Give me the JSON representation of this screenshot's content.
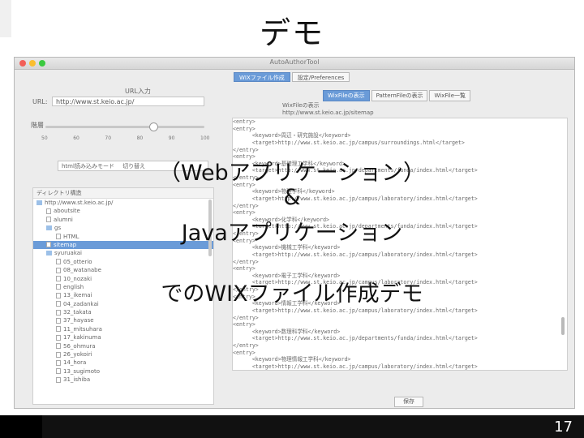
{
  "slide": {
    "title": "デモ",
    "page_number": "17",
    "caption": {
      "line1": "（Webアプリケーション）",
      "line2": "&",
      "line3": "Javaアプリケーション",
      "line4": "でのWIXファイル作成デモ"
    }
  },
  "window": {
    "title": "AutoAuthorTool",
    "tabs": [
      "WIXファイル作成",
      "設定/Preferences"
    ],
    "active_tab": 0
  },
  "left_panel": {
    "url_section_label": "URL入力",
    "url_label": "URL:",
    "url_value": "http://www.st.keio.ac.jp/",
    "depth_label": "階層",
    "slider_ticks": [
      "50",
      "60",
      "70",
      "80",
      "90",
      "100"
    ],
    "slider_value_percent": 68,
    "mode_label": "html読み込みモード",
    "mode_value": "切り替え",
    "tree_header": "ディレクトリ構造",
    "tree": [
      {
        "label": "http://www.st.keio.ac.jp/",
        "type": "folder",
        "level": 0
      },
      {
        "label": "aboutsite",
        "type": "file",
        "level": 1
      },
      {
        "label": "alumni",
        "type": "file",
        "level": 1
      },
      {
        "label": "gs",
        "type": "folder",
        "level": 1
      },
      {
        "label": "HTML",
        "type": "file",
        "level": 2
      },
      {
        "label": "sitemap",
        "type": "file",
        "level": 1,
        "selected": true
      },
      {
        "label": "syuruakai",
        "type": "folder",
        "level": 1
      },
      {
        "label": "05_otterio",
        "type": "file",
        "level": 2
      },
      {
        "label": "08_watanabe",
        "type": "file",
        "level": 2
      },
      {
        "label": "10_nozaki",
        "type": "file",
        "level": 2
      },
      {
        "label": "english",
        "type": "file",
        "level": 2
      },
      {
        "label": "13_ikemai",
        "type": "file",
        "level": 2
      },
      {
        "label": "04_zadankai",
        "type": "file",
        "level": 2
      },
      {
        "label": "32_takata",
        "type": "file",
        "level": 2
      },
      {
        "label": "37_hayase",
        "type": "file",
        "level": 2
      },
      {
        "label": "11_mitsuhara",
        "type": "file",
        "level": 2
      },
      {
        "label": "17_kakinuma",
        "type": "file",
        "level": 2
      },
      {
        "label": "56_ohmura",
        "type": "file",
        "level": 2
      },
      {
        "label": "26_yokoiri",
        "type": "file",
        "level": 2
      },
      {
        "label": "14_hora",
        "type": "file",
        "level": 2
      },
      {
        "label": "13_sugimoto",
        "type": "file",
        "level": 2
      },
      {
        "label": "31_ishiba",
        "type": "file",
        "level": 2
      }
    ]
  },
  "right_panel": {
    "subtabs": [
      "WixFileの表示",
      "PatternFileの表示",
      "WixFile一覧"
    ],
    "active_subtab": 0,
    "file_label": "WixFileの表示",
    "file_url": "http://www.st.keio.ac.jp/sitemap",
    "xml_lines": [
      "<entry>",
      "<entry>",
      "      <keyword>周辺・研究施設</keyword>",
      "      <target>http://www.st.keio.ac.jp/campus/surroundings.html</target>",
      "</entry>",
      "<entry>",
      "      <keyword>基礎理工学科</keyword>",
      "      <target>http://www.st.keio.ac.jp/departments/funda/index.html</target>",
      "</entry>",
      "<entry>",
      "      <keyword>物理学科</keyword>",
      "      <target>http://www.st.keio.ac.jp/campus/laboratory/index.html</target>",
      "</entry>",
      "<entry>",
      "      <keyword>化学科</keyword>",
      "      <target>http://www.st.keio.ac.jp/departments/funda/index.html</target>",
      "</entry>",
      "<entry>",
      "      <keyword>機械工学科</keyword>",
      "      <target>http://www.st.keio.ac.jp/campus/laboratory/index.html</target>",
      "</entry>",
      "<entry>",
      "      <keyword>電子工学科</keyword>",
      "      <target>http://www.st.keio.ac.jp/campus/laboratory/index.html</target>",
      "</entry>",
      "<entry>",
      "      <keyword>情報工学科</keyword>",
      "      <target>http://www.st.keio.ac.jp/campus/laboratory/index.html</target>",
      "</entry>",
      "<entry>",
      "      <keyword>数理科学科</keyword>",
      "      <target>http://www.st.keio.ac.jp/departments/funda/index.html</target>",
      "</entry>",
      "<entry>",
      "      <keyword>物理情報工学科</keyword>",
      "      <target>http://www.st.keio.ac.jp/campus/laboratory/index.html</target>",
      "</entry>"
    ],
    "save_button": "保存"
  },
  "colors": {
    "accent": "#6a9bd8",
    "footer": "#111111",
    "close_dot": "#f25f58",
    "min_dot": "#fbbe2f",
    "max_dot": "#3bc93f"
  }
}
